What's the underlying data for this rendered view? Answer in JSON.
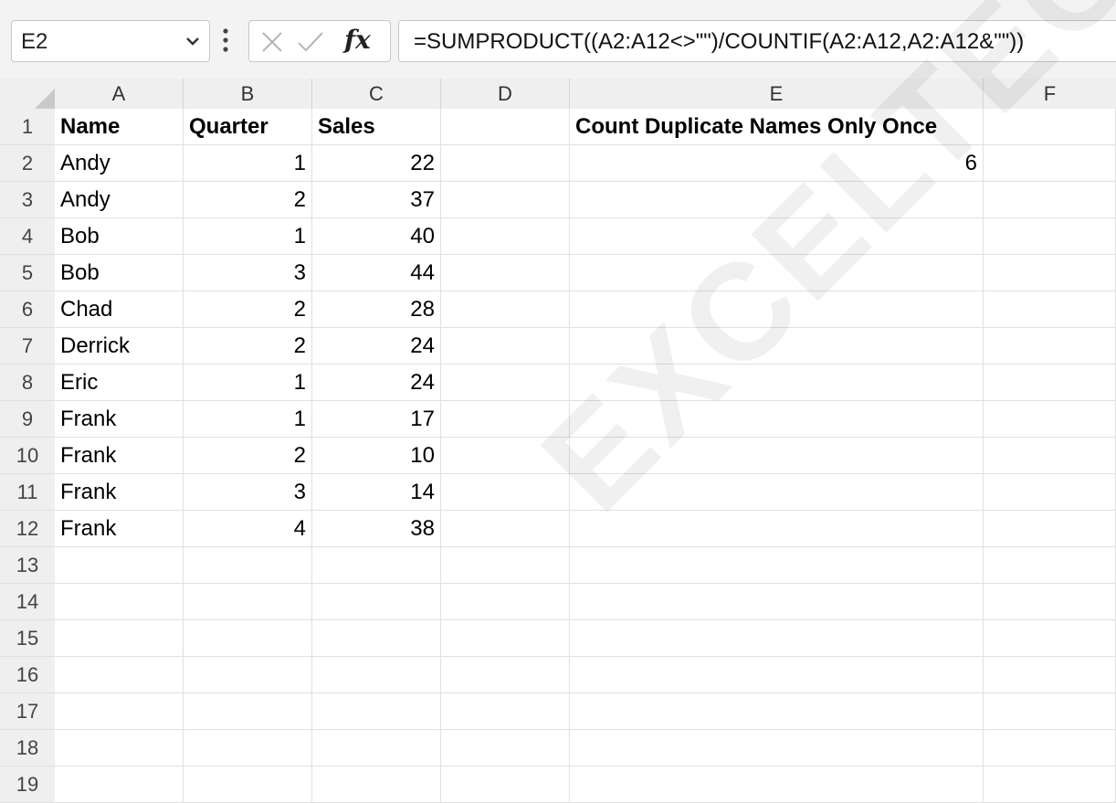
{
  "formula_bar": {
    "name_box": "E2",
    "formula": "=SUMPRODUCT((A2:A12<>\"\")/COUNTIF(A2:A12,A2:A12&\"\"))",
    "fx_label": "fx"
  },
  "columns": [
    "A",
    "B",
    "C",
    "D",
    "E",
    "F"
  ],
  "rows": [
    "1",
    "2",
    "3",
    "4",
    "5",
    "6",
    "7",
    "8",
    "9",
    "10",
    "11",
    "12",
    "13",
    "14",
    "15",
    "16",
    "17",
    "18",
    "19"
  ],
  "sheet": {
    "headers": {
      "name": "Name",
      "quarter": "Quarter",
      "sales": "Sales",
      "e1": "Count Duplicate Names Only Once"
    },
    "e2": "6",
    "data": [
      {
        "name": "Andy",
        "quarter": "1",
        "sales": "22"
      },
      {
        "name": "Andy",
        "quarter": "2",
        "sales": "37"
      },
      {
        "name": "Bob",
        "quarter": "1",
        "sales": "40"
      },
      {
        "name": "Bob",
        "quarter": "3",
        "sales": "44"
      },
      {
        "name": "Chad",
        "quarter": "2",
        "sales": "28"
      },
      {
        "name": "Derrick",
        "quarter": "2",
        "sales": "24"
      },
      {
        "name": "Eric",
        "quarter": "1",
        "sales": "24"
      },
      {
        "name": "Frank",
        "quarter": "1",
        "sales": "17"
      },
      {
        "name": "Frank",
        "quarter": "2",
        "sales": "10"
      },
      {
        "name": "Frank",
        "quarter": "3",
        "sales": "14"
      },
      {
        "name": "Frank",
        "quarter": "4",
        "sales": "38"
      }
    ]
  },
  "watermark": "EXCELTECHNOLOGY.COM"
}
